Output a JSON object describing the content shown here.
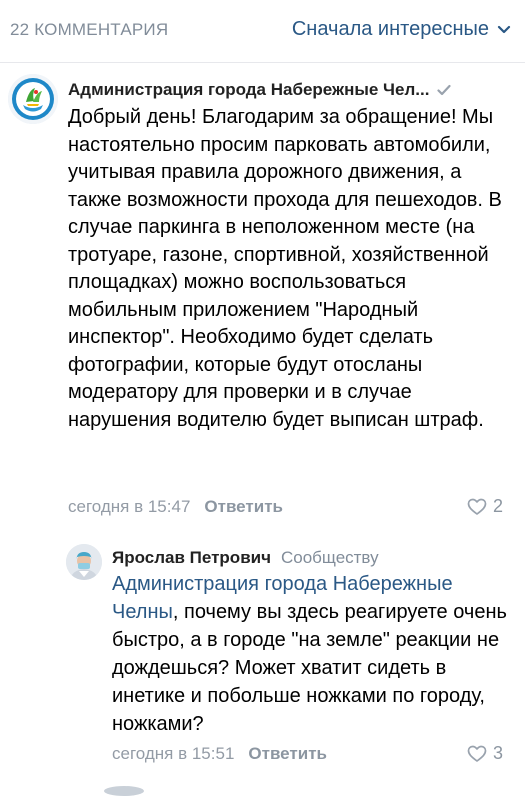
{
  "header": {
    "comment_count": "22 КОММЕНТАРИЯ",
    "sort_label": "Сначала интересные"
  },
  "comments": [
    {
      "author": "Администрация города Набережные Чел...",
      "text": "Добрый день! Благодарим за обращение! Мы настоятельно просим парковать автомобили, учитывая правила дорожного движения, а также возможности прохода для пешеходов. В случае паркинга в неположенном месте (на тротуаре, газоне, спортивной, хозяйственной площадках) можно воспользоваться мобильным приложением \"Народный инспектор\". Необходимо будет сделать фотографии, которые будут отосланы модератору для проверки и в случае нарушения водителю будет выписан штраф.",
      "time": "сегодня в 15:47",
      "reply_label": "Ответить",
      "likes": "2"
    },
    {
      "author": "Ярослав Петрович",
      "reply_to": "Сообществу",
      "mention": "Администрация города Набережные Челны",
      "text": ", почему вы здесь реагируете очень быстро, а в городе \"на земле\" реакции не дождешься? Может хватит сидеть в инетике и побольше ножками по городу, ножками?",
      "time": "сегодня в 15:51",
      "reply_label": "Ответить",
      "likes": "3"
    }
  ],
  "colors": {
    "link": "#2a5885",
    "secondary": "#818c99",
    "verified": "#99a2ad"
  }
}
